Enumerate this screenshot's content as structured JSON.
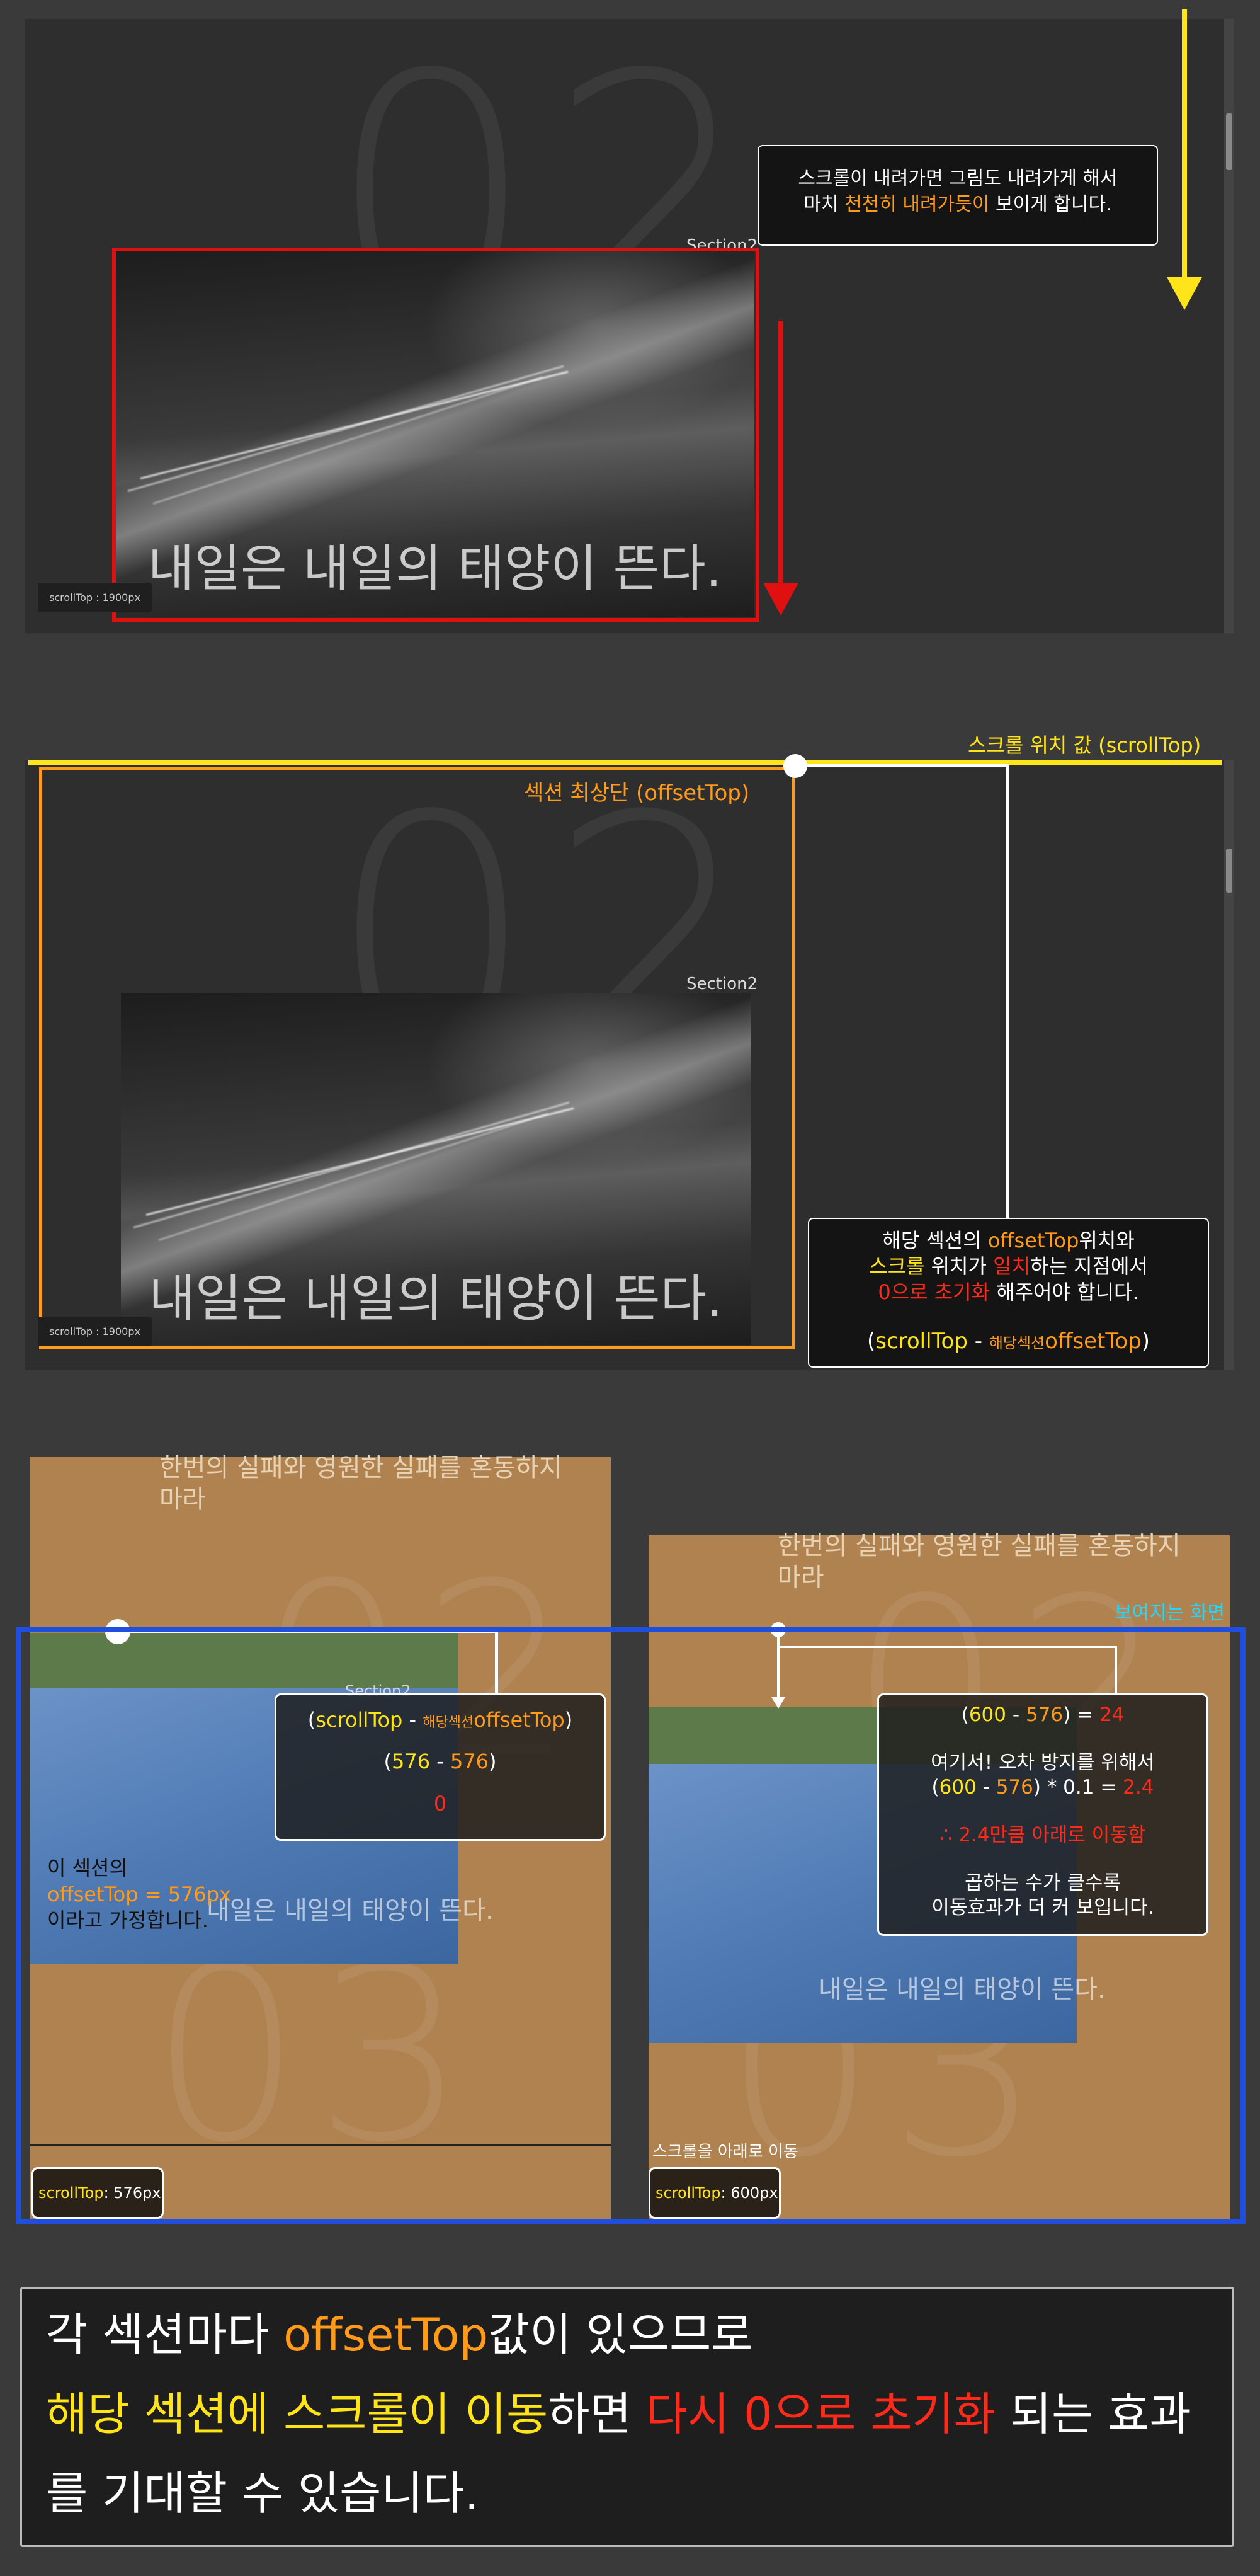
{
  "panel1": {
    "section_label": "Section2",
    "caption": "내일은 내일의 태양이 뜬다.",
    "scroll_badge": "scrollTop : 1900px",
    "callout_line1": "스크롤이 내려가면 그림도 내려가게 해서",
    "callout_line2_prefix": "마치 ",
    "callout_line2_highlight": "천천히 내려가듯이",
    "callout_line2_suffix": " 보이게 합니다.",
    "big_number": "02"
  },
  "panel2": {
    "scroll_value_label": "스크롤 위치 값 (scrollTop)",
    "offset_label": "섹션 최상단 (offsetTop)",
    "section_label": "Section2",
    "caption": "내일은 내일의 태양이 뜬다.",
    "scroll_badge": "scrollTop : 1900px",
    "big_number": "02",
    "callout": {
      "l1_prefix": "해당 섹션의 ",
      "l1_highlight": "offsetTop",
      "l1_suffix": "위치와",
      "l2_highlight1": "스크롤",
      "l2_mid": " 위치가 ",
      "l2_highlight2": "일치",
      "l2_suffix": "하는 지점에서",
      "l3_highlight": "0으로 초기화",
      "l3_suffix": " 해주어야 합니다.",
      "l4_open": "(",
      "l4_scroll": "scrollTop",
      "l4_minus": " - ",
      "l4_small": "해당섹션",
      "l4_offset": "offsetTop",
      "l4_close": ")"
    }
  },
  "panel3": {
    "left": {
      "top_text": "한번의 실패와 영원한 실패를 혼동하지 마라",
      "section_label": "Section2",
      "caption": "내일은 내일의 태양이 뜬다.",
      "assume_l1": "이 섹션의",
      "assume_l2_offset": "offsetTop = ",
      "assume_l2_value": "576px",
      "assume_l3": "이라고 가정합니다.",
      "badge_label": "scrollTop",
      "badge_value": ": 576px",
      "formula": {
        "open": "(",
        "scroll": "scrollTop",
        "minus": " - ",
        "small": "해당섹션",
        "offset": "offsetTop",
        "close": ")",
        "calc_open": "(",
        "calc_a": "576",
        "calc_minus": " - ",
        "calc_b": "576",
        "calc_close": ")",
        "result": "0"
      }
    },
    "right": {
      "top_text": "한번의 실패와 영원한 실패를 혼동하지 마라",
      "visible_label": "보여지는 화면",
      "caption": "내일은 내일의 태양이 뜬다.",
      "scroll_down_label": "스크롤을 아래로 이동",
      "badge_label": "scrollTop",
      "badge_value": ": 600px",
      "formula": {
        "l1_open": "(",
        "l1_a": "600",
        "l1_minus": " - ",
        "l1_b": "576",
        "l1_eq": ") = ",
        "l1_result": "24",
        "l2": "여기서! 오차 방지를 위해서",
        "l3_open": "(",
        "l3_a": "600",
        "l3_minus": " - ",
        "l3_b": "576",
        "l3_rest": ") * 0.1 = ",
        "l3_result": "2.4",
        "l4": "∴ 2.4만큼 아래로 이동함",
        "l5": "곱하는 수가 클수록",
        "l6": "이동효과가 더 커 보입니다."
      }
    }
  },
  "summary": {
    "l1_highlight": "offsetTop",
    "l1_prefix": "각 섹션마다 ",
    "l1_suffix": "값이 있으므로",
    "l2_yellow": "해당 섹션에 스크롤이 이동",
    "l2_mid": "하면 ",
    "l2_red": "다시 0으로 초기화",
    "l2_suffix": " 되는 효과",
    "l3": "를 기대할 수 있습니다."
  },
  "colors": {
    "yellow": "#ffe41a",
    "orange": "#ff9a1a",
    "red": "#ff2a1a",
    "blue": "#1f4fe0",
    "cyan": "#20d8ff"
  }
}
